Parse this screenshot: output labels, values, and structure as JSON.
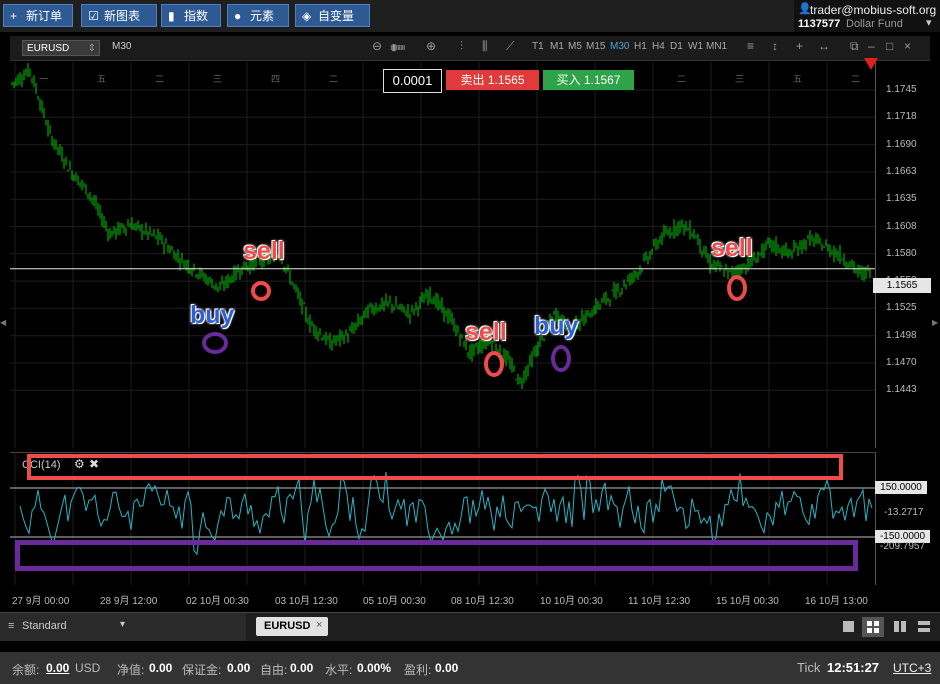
{
  "toolbar": {
    "new_order": "新订单",
    "new_chart": "新图表",
    "indicators": "指数",
    "elements": "元素",
    "custom_vars": "自变量"
  },
  "account": {
    "email": "trader@mobius-soft.org",
    "number": "1137577",
    "fund": "Dollar Fund"
  },
  "chart_toolbar": {
    "symbol": "EURUSD",
    "timeframe": "M30",
    "timeframes": [
      "T1",
      "M1",
      "M5",
      "M15",
      "M30",
      "H1",
      "H4",
      "D1",
      "W1",
      "MN1"
    ],
    "active_timeframe": "M30"
  },
  "quote": {
    "lot": "0.0001",
    "sell_label": "卖出",
    "sell_price": "1.1565",
    "buy_label": "买入",
    "buy_price": "1.1567"
  },
  "price_axis": [
    "1.1745",
    "1.1718",
    "1.1690",
    "1.1663",
    "1.1635",
    "1.1608",
    "1.1580",
    "1.1553",
    "1.1525",
    "1.1498",
    "1.1470",
    "1.1443"
  ],
  "current_price": "1.1565",
  "cci": {
    "title": "CCI(14)",
    "axis_labels": [
      "150.0000",
      "-13.2717",
      "-150.0000",
      "-209.7957"
    ]
  },
  "time_axis": [
    "27 9月 00:00",
    "28 9月 12:00",
    "02 10月 00:30",
    "03 10月 12:30",
    "05 10月 00:30",
    "08 10月 12:30",
    "10 10月 00:30",
    "11 10月 12:30",
    "15 10月 00:30",
    "16 10月 13:00"
  ],
  "day_markers": [
    "一",
    "五",
    "二",
    "三",
    "四",
    "二",
    "四",
    "二",
    "三",
    "四",
    "一",
    "二",
    "三",
    "五",
    "二"
  ],
  "annotations": {
    "sell": "sell",
    "buy": "buy"
  },
  "tabs": {
    "profile": "Standard",
    "chart_tab": "EURUSD"
  },
  "status": {
    "balance_label": "余额:",
    "balance_value": "0.00",
    "balance_currency": "USD",
    "equity_label": "净值:",
    "equity_value": "0.00",
    "margin_label": "保证金:",
    "margin_value": "0.00",
    "free_label": "自由:",
    "free_value": "0.00",
    "level_label": "水平:",
    "level_value": "0.00%",
    "profit_label": "盈利:",
    "profit_value": "0.00",
    "tick_label": "Tick",
    "time": "12:51:27",
    "timezone": "UTC+3"
  },
  "colors": {
    "candle": "#00c800",
    "cci_line": "#27b5c4",
    "sell_annotation": "#f04a4a",
    "buy_annotation": "#2e5fd6",
    "sell_ring": "#f04a4a",
    "buy_ring": "#6a2a9a",
    "toolbar_button": "#2e5a94"
  }
}
